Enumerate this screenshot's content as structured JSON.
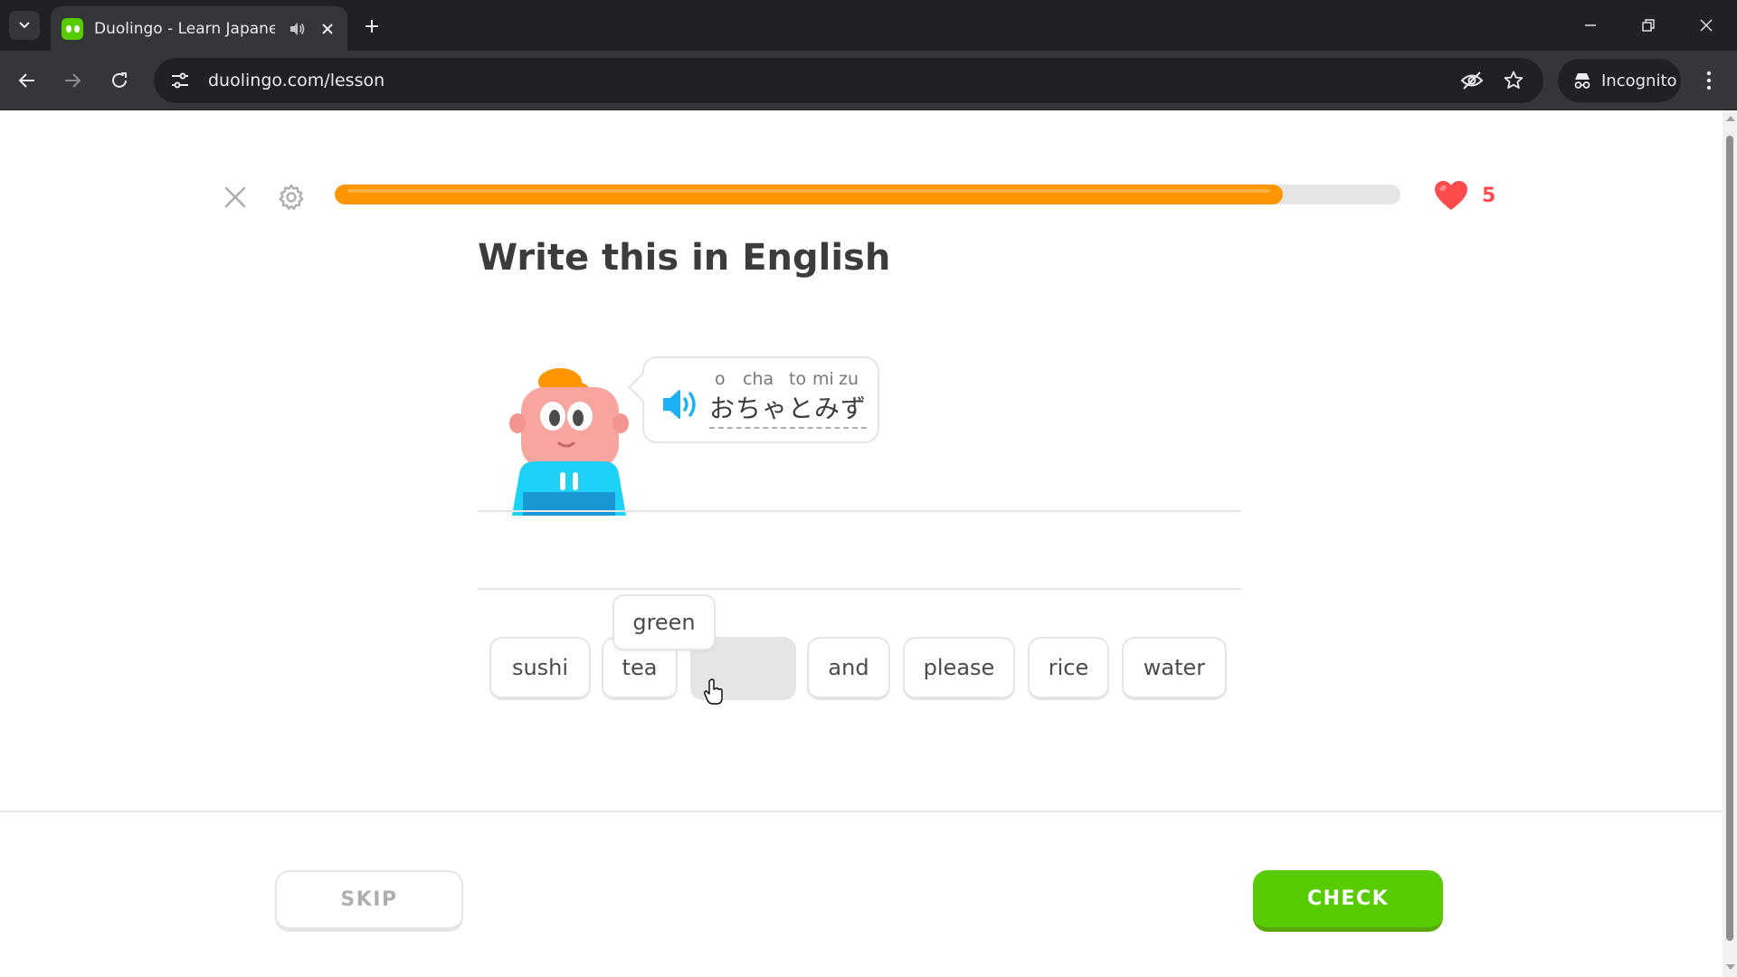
{
  "browser": {
    "tab_title": "Duolingo - Learn Japanese",
    "url": "duolingo.com/lesson",
    "incognito_label": "Incognito"
  },
  "lesson": {
    "progress_fraction": 0.89,
    "hearts": "5",
    "prompt_title": "Write this in English",
    "romaji": [
      "o",
      "cha",
      "to",
      "mi",
      "zu"
    ],
    "kana": "おちゃとみず",
    "tooltip_word": "green",
    "word_bank": [
      {
        "label": "sushi",
        "used": false
      },
      {
        "label": "tea",
        "used": false
      },
      {
        "label": "green",
        "used": true
      },
      {
        "label": "and",
        "used": false
      },
      {
        "label": "please",
        "used": false
      },
      {
        "label": "rice",
        "used": false
      },
      {
        "label": "water",
        "used": false
      }
    ],
    "skip_label": "SKIP",
    "check_label": "CHECK"
  },
  "colors": {
    "progress": "#ff9600",
    "heart": "#ff4b4b",
    "check": "#58cc02",
    "speaker": "#1cb0f6"
  }
}
